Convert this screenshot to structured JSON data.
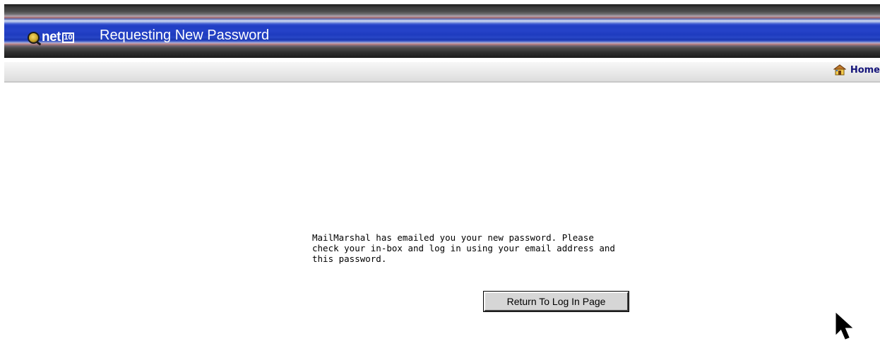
{
  "header": {
    "logo": "net",
    "logo_box": "10",
    "title": "Requesting New Password"
  },
  "nav": {
    "home_label": "Home",
    "home_icon": "home-icon"
  },
  "main": {
    "message": "MailMarshal has emailed you your new password. Please\ncheck your in-box and log in using your email address and\nthis password.",
    "return_button_label": "Return To Log In Page"
  },
  "colors": {
    "banner_blue": "#2542c8",
    "home_link": "#15157a"
  }
}
